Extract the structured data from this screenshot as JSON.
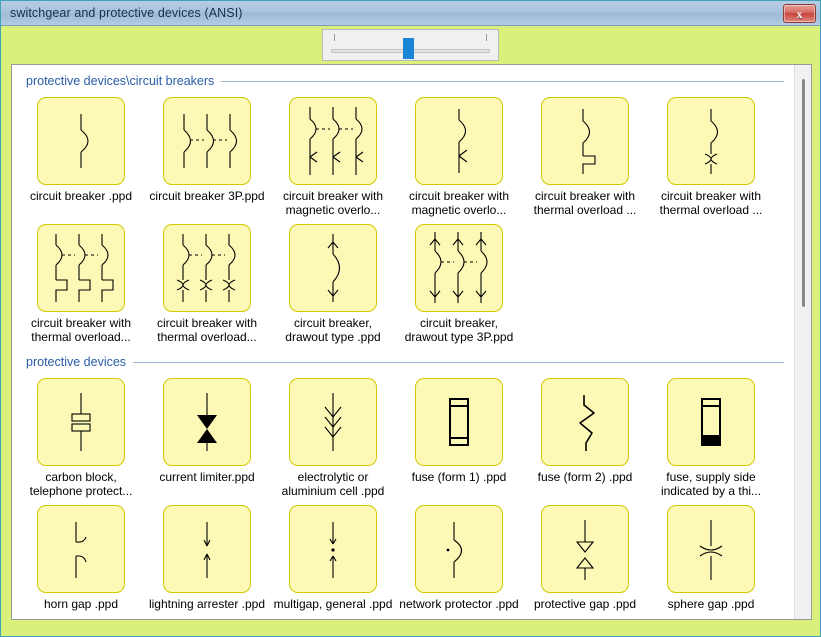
{
  "window": {
    "title": "switchgear and protective devices (ANSI)",
    "close_label": "x",
    "accent_background": "#d9f07a",
    "titlebar_color": "#a8c3dd",
    "tile_fill": "#fcf8b6",
    "tile_border": "#d4c800",
    "section_title_color": "#2b5ca8"
  },
  "slider": {
    "name": "zoom-slider",
    "value_percent": 48
  },
  "scrollbar": {
    "thumb_position_percent": 3
  },
  "sections": [
    {
      "title": "protective devices\\circuit breakers",
      "items": [
        {
          "label": "circuit breaker .ppd",
          "symbol": "cb-1p"
        },
        {
          "label": "circuit breaker 3P.ppd",
          "symbol": "cb-3p"
        },
        {
          "label": "circuit breaker with magnetic overlo...",
          "symbol": "cb-mag-3p"
        },
        {
          "label": "circuit breaker with magnetic overlo...",
          "symbol": "cb-mag-1p"
        },
        {
          "label": "circuit breaker with thermal overload ...",
          "symbol": "cb-thermal-1p"
        },
        {
          "label": "circuit breaker with thermal overload ...",
          "symbol": "cb-thermal-x-1p"
        },
        {
          "label": "circuit breaker with thermal overload...",
          "symbol": "cb-thermal-3p"
        },
        {
          "label": "circuit breaker with thermal overload...",
          "symbol": "cb-thermal-x-3p"
        },
        {
          "label": "circuit breaker, drawout type .ppd",
          "symbol": "cb-drawout-1p"
        },
        {
          "label": "circuit breaker, drawout type 3P.ppd",
          "symbol": "cb-drawout-3p"
        }
      ]
    },
    {
      "title": "protective devices",
      "items": [
        {
          "label": "carbon block, telephone protect...",
          "symbol": "carbon-block"
        },
        {
          "label": "current limiter.ppd",
          "symbol": "current-limiter"
        },
        {
          "label": "electrolytic or aluminium cell .ppd",
          "symbol": "electrolytic-cell"
        },
        {
          "label": "fuse (form 1) .ppd",
          "symbol": "fuse-form1"
        },
        {
          "label": "fuse (form 2) .ppd",
          "symbol": "fuse-form2"
        },
        {
          "label": "fuse, supply side indicated by a thi...",
          "symbol": "fuse-supply"
        },
        {
          "label": "horn gap .ppd",
          "symbol": "horn-gap"
        },
        {
          "label": "lightning arrester .ppd",
          "symbol": "lightning-arrester"
        },
        {
          "label": "multigap, general .ppd",
          "symbol": "multigap"
        },
        {
          "label": "network protector .ppd",
          "symbol": "network-protector"
        },
        {
          "label": "protective gap .ppd",
          "symbol": "protective-gap"
        },
        {
          "label": "sphere gap .ppd",
          "symbol": "sphere-gap"
        }
      ]
    }
  ]
}
